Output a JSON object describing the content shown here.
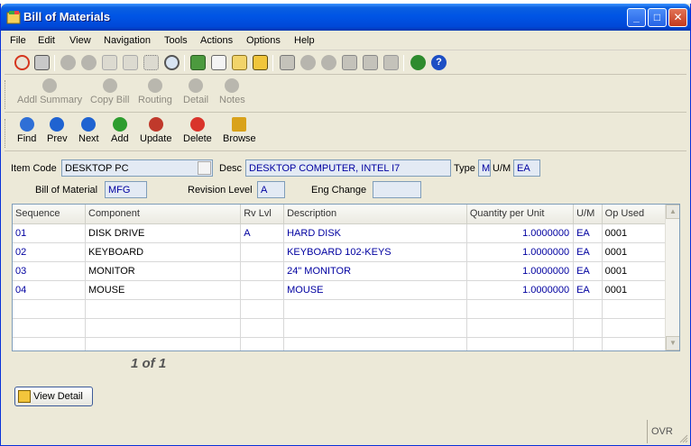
{
  "window": {
    "title": "Bill of Materials"
  },
  "menu": [
    "File",
    "Edit",
    "View",
    "Navigation",
    "Tools",
    "Actions",
    "Options",
    "Help"
  ],
  "toolbar_icons": [
    "power-icon",
    "print-icon",
    "check-icon",
    "cancel-icon",
    "copy-icon",
    "paste-icon",
    "select-icon",
    "find-icon",
    "notes-icon",
    "attach-icon",
    "report-icon",
    "schedule-icon",
    "import-icon",
    "down-icon",
    "up-icon",
    "insert-icon",
    "remove-icon",
    "undo-icon",
    "chart-icon",
    "help-icon"
  ],
  "actions_toolbar": [
    {
      "label": "Addl Summary",
      "icon": "plus-icon"
    },
    {
      "label": "Copy Bill",
      "icon": "plus-icon"
    },
    {
      "label": "Routing",
      "icon": "plus-icon"
    },
    {
      "label": "Detail",
      "icon": "plus-icon"
    },
    {
      "label": "Notes",
      "icon": "plus-icon"
    }
  ],
  "nav_toolbar": [
    {
      "label": "Find",
      "icon": "magnifier-icon",
      "color": "#2f6fd6"
    },
    {
      "label": "Prev",
      "icon": "arrow-left-icon",
      "color": "#1f63d1"
    },
    {
      "label": "Next",
      "icon": "arrow-right-icon",
      "color": "#1f63d1"
    },
    {
      "label": "Add",
      "icon": "plus-green-icon",
      "color": "#2e9d2e"
    },
    {
      "label": "Update",
      "icon": "refresh-icon",
      "color": "#c0392b"
    },
    {
      "label": "Delete",
      "icon": "delete-icon",
      "color": "#d9342b"
    },
    {
      "label": "Browse",
      "icon": "folder-icon",
      "color": "#d9a21b"
    }
  ],
  "form": {
    "item_code_label": "Item Code",
    "item_code": "DESKTOP PC",
    "desc_label": "Desc",
    "desc": "DESKTOP COMPUTER, INTEL I7",
    "type_label": "Type",
    "type": "M",
    "um_label": "U/M",
    "um": "EA",
    "bom_label": "Bill of Material",
    "bom": "MFG",
    "revision_label": "Revision Level",
    "revision": "A",
    "eng_change_label": "Eng Change",
    "eng_change": ""
  },
  "grid": {
    "columns": [
      "Sequence",
      "Component",
      "Rv Lvl",
      "Description",
      "Quantity per Unit",
      "U/M",
      "Op Used"
    ],
    "rows": [
      {
        "seq": "01",
        "component": "DISK DRIVE",
        "rv": "A",
        "desc": "HARD DISK",
        "qty": "1.0000000",
        "um": "EA",
        "op": "0001"
      },
      {
        "seq": "02",
        "component": "KEYBOARD",
        "rv": "",
        "desc": "KEYBOARD 102-KEYS",
        "qty": "1.0000000",
        "um": "EA",
        "op": "0001"
      },
      {
        "seq": "03",
        "component": "MONITOR",
        "rv": "",
        "desc": "24\" MONITOR",
        "qty": "1.0000000",
        "um": "EA",
        "op": "0001"
      },
      {
        "seq": "04",
        "component": "MOUSE",
        "rv": "",
        "desc": "MOUSE",
        "qty": "1.0000000",
        "um": "EA",
        "op": "0001"
      }
    ]
  },
  "pager": "1 of 1",
  "view_detail_label": "View Detail",
  "status": "OVR"
}
